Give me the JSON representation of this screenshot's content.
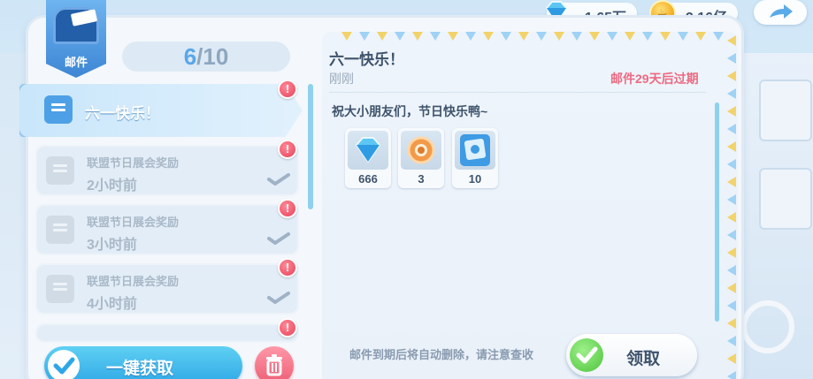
{
  "currency": {
    "diamond": {
      "value": "1.65万",
      "icon": "diamond-icon"
    },
    "coin": {
      "value": "2.16亿",
      "icon": "coin-icon"
    }
  },
  "mailbox": {
    "label": "邮件"
  },
  "counter": {
    "current": "6",
    "separator": "/",
    "total": "10"
  },
  "mail_list": [
    {
      "title": "六一快乐！",
      "time": "",
      "selected": true,
      "unread": "!"
    },
    {
      "title": "联盟节日展会奖励",
      "time": "2小时前",
      "selected": false,
      "unread": "!"
    },
    {
      "title": "联盟节日展会奖励",
      "time": "3小时前",
      "selected": false,
      "unread": "!"
    },
    {
      "title": "联盟节日展会奖励",
      "time": "4小时前",
      "selected": false,
      "unread": "!"
    }
  ],
  "buttons": {
    "collect_all": "一键获取",
    "claim": "领取"
  },
  "detail": {
    "title": "六一快乐！",
    "time": "刚刚",
    "expire": "邮件29天后过期",
    "body": "祝大小朋友们，节日快乐鸭~",
    "rewards": [
      {
        "icon": "diamond-icon",
        "qty": "666"
      },
      {
        "icon": "medal-icon",
        "qty": "3"
      },
      {
        "icon": "card-icon",
        "qty": "10"
      }
    ],
    "notice": "邮件到期后将自动删除，请注意查收"
  },
  "colors": {
    "accent_blue": "#3d86d4",
    "alert_red": "#e83f58",
    "expire_pink": "#ec6a82",
    "claim_green": "#4fc43b"
  }
}
